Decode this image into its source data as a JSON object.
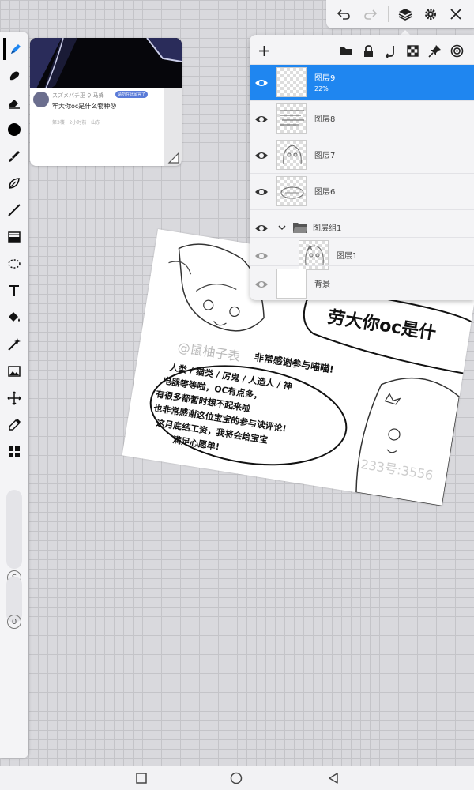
{
  "toolbar": {
    "tools": [
      {
        "icon": "brush-pen-icon",
        "active": true
      },
      {
        "icon": "smudge-icon"
      },
      {
        "icon": "eraser-icon"
      },
      {
        "icon": "color-swatch-icon"
      },
      {
        "icon": "paint-brush-icon"
      },
      {
        "icon": "leaf-brush-icon"
      },
      {
        "icon": "line-tool-icon"
      },
      {
        "icon": "gradient-fill-icon"
      },
      {
        "icon": "lasso-select-icon"
      },
      {
        "icon": "text-tool-icon"
      },
      {
        "icon": "bucket-fill-icon"
      },
      {
        "icon": "magic-wand-icon"
      },
      {
        "icon": "image-import-icon"
      },
      {
        "icon": "transform-move-icon"
      },
      {
        "icon": "eyedropper-icon"
      },
      {
        "icon": "grid-layout-icon"
      }
    ],
    "size_label": "S",
    "opacity_label": "0",
    "active_color": "#000000"
  },
  "reference": {
    "username": "スズメバチ巫 ♀ 马蜂",
    "badge": "请勿在此留言了",
    "post_text": "牢大你oc是什么物种😵",
    "meta": "第3楼 · 2小时前 · 山东"
  },
  "topbar": {
    "buttons": [
      "undo-icon",
      "redo-icon",
      "layers-icon",
      "settings-icon",
      "close-icon"
    ]
  },
  "layers_panel": {
    "toolbar": [
      "add-layer-icon",
      "folder-icon",
      "lock-icon",
      "clipping-icon",
      "checkerboard-icon",
      "pin-icon",
      "target-icon"
    ],
    "layers": [
      {
        "name": "图层9",
        "opacity": "22%",
        "selected": true
      },
      {
        "name": "图层8"
      },
      {
        "name": "图层7"
      },
      {
        "name": "图层6"
      },
      {
        "name": "图层组1",
        "group": true
      },
      {
        "name": "图层1",
        "child": true
      },
      {
        "name": "背景"
      }
    ]
  },
  "artwork": {
    "title": "劳大你oc是什",
    "signature": "@鼠柚子表",
    "thanks": "非常感谢参与喵喵!",
    "bubble_lines": [
      "人类 / 猫类 / 厉鬼 / 人造人 / 神",
      "电器等等啦，OC有点多，",
      "有很多都暂时想不起来啦",
      "也非常感谢这位宝宝的参与读评论!",
      "这月底结工资，我将会给宝宝",
      "满足心愿单!"
    ],
    "watermark": "233号:3556"
  },
  "navbar": {
    "buttons": [
      "recent-apps-icon",
      "home-icon",
      "back-icon"
    ]
  }
}
